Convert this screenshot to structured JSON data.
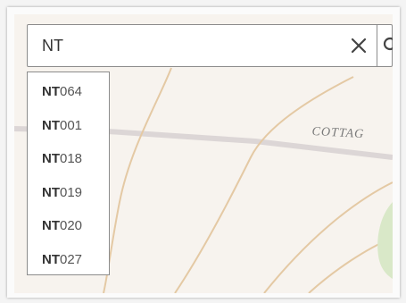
{
  "search": {
    "value": "NT",
    "placeholder": ""
  },
  "icons": {
    "clear": "close-icon",
    "search": "search-icon"
  },
  "suggestions": [
    {
      "match": "NT",
      "rest": "064"
    },
    {
      "match": "NT",
      "rest": "001"
    },
    {
      "match": "NT",
      "rest": "018"
    },
    {
      "match": "NT",
      "rest": "019"
    },
    {
      "match": "NT",
      "rest": "020"
    },
    {
      "match": "NT",
      "rest": "027"
    }
  ],
  "map": {
    "road_label": "COTTAG"
  },
  "colors": {
    "map_background": "#f7f3ee",
    "road_major": "#dcd6d6",
    "road_minor": "#e4c9a4",
    "park": "#d9e8c8"
  }
}
